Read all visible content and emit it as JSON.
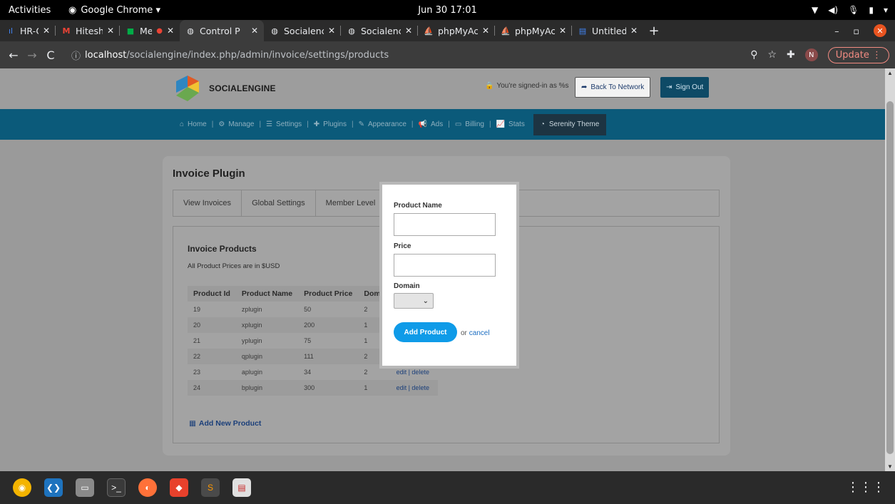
{
  "system_bar": {
    "activities": "Activities",
    "app_name": "Google Chrome ▾",
    "clock": "Jun 30  17:01"
  },
  "browser": {
    "tabs": [
      {
        "label": "HR-One",
        "favicon": "hr-one-icon",
        "color": "#4285f4"
      },
      {
        "label": "Hitesh Ji",
        "favicon": "gmail-icon",
        "color": "#ea4335"
      },
      {
        "label": "Meet",
        "favicon": "meet-icon",
        "color": "#00ac47"
      },
      {
        "label": "Control P",
        "favicon": "chrome-globe-icon",
        "color": "#e8eaed"
      },
      {
        "label": "Socialenc",
        "favicon": "chrome-globe-icon",
        "color": "#e8eaed"
      },
      {
        "label": "Socialenc",
        "favicon": "chrome-globe-icon",
        "color": "#e8eaed"
      },
      {
        "label": "phpMyAc",
        "favicon": "phpmyadmin-icon",
        "color": "#f5a623"
      },
      {
        "label": "phpMyAc",
        "favicon": "phpmyadmin-icon",
        "color": "#f5a623"
      },
      {
        "label": "Untitled",
        "favicon": "docs-icon",
        "color": "#4285f4"
      }
    ],
    "url_host": "localhost",
    "url_path": "/socialengine/index.php/admin/invoice/settings/products",
    "profile_initial": "N",
    "update_label": "Update"
  },
  "header": {
    "logo_text": "SOCIALENGINE",
    "signed_in_text": "You're signed-in as %s",
    "back_button": "Back To Network",
    "signout_button": "Sign Out"
  },
  "nav": {
    "items": [
      "Home",
      "Manage",
      "Settings",
      "Plugins",
      "Appearance",
      "Ads",
      "Billing",
      "Stats"
    ],
    "theme": "Serenity Theme"
  },
  "plugin": {
    "title": "Invoice Plugin",
    "tabs": [
      "View Invoices",
      "Global Settings",
      "Member Level"
    ],
    "section_title": "Invoice Products",
    "note": "All Product Prices are in $USD",
    "columns": [
      "Product Id",
      "Product Name",
      "Product Price",
      "Doma"
    ],
    "rows": [
      {
        "id": "19",
        "name": "zplugin",
        "price": "50",
        "domain": "2",
        "actions": ""
      },
      {
        "id": "20",
        "name": "xplugin",
        "price": "200",
        "domain": "1",
        "actions": ""
      },
      {
        "id": "21",
        "name": "yplugin",
        "price": "75",
        "domain": "1",
        "actions": ""
      },
      {
        "id": "22",
        "name": "qplugin",
        "price": "111",
        "domain": "2",
        "actions": ""
      },
      {
        "id": "23",
        "name": "aplugin",
        "price": "34",
        "domain": "2",
        "actions": "edit | delete"
      },
      {
        "id": "24",
        "name": "bplugin",
        "price": "300",
        "domain": "1",
        "actions": "edit | delete"
      }
    ],
    "add_new": "Add New Product"
  },
  "modal": {
    "product_name_label": "Product Name",
    "product_name_value": "",
    "price_label": "Price",
    "price_value": "",
    "domain_label": "Domain",
    "domain_value": "",
    "add_button": "Add Product",
    "or_text": "or",
    "cancel_link": "cancel"
  }
}
